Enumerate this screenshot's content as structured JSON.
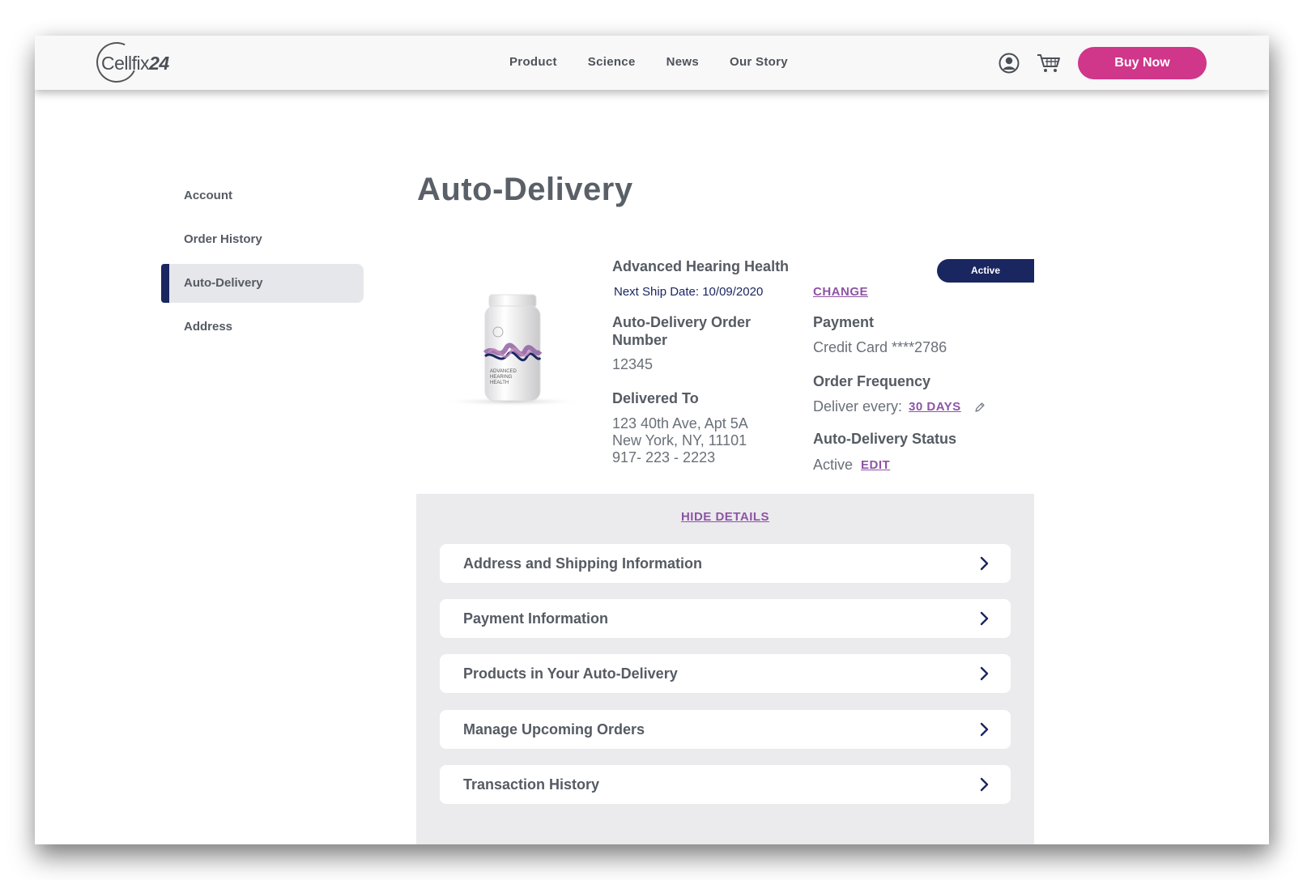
{
  "header": {
    "logo_text": "Cellfix",
    "logo_num": "24",
    "nav": [
      "Product",
      "Science",
      "News",
      "Our Story"
    ],
    "buy_label": "Buy Now"
  },
  "sidebar": {
    "items": [
      {
        "label": "Account",
        "active": false
      },
      {
        "label": "Order History",
        "active": false
      },
      {
        "label": "Auto-Delivery",
        "active": true
      },
      {
        "label": "Address",
        "active": false
      }
    ]
  },
  "page": {
    "title": "Auto-Delivery"
  },
  "order": {
    "product_name": "Advanced Hearing Health",
    "ship_date": "Next Ship Date: 10/09/2020",
    "change_label": "CHANGE",
    "status_badge": "Active",
    "order_num_label": "Auto-Delivery Order Number",
    "order_num": "12345",
    "delivered_label": "Delivered To",
    "address_line1": "123 40th Ave, Apt 5A",
    "address_line2": "New York, NY, 11101",
    "phone": "917- 223 - 2223",
    "payment_label": "Payment",
    "payment_value": "Credit Card ****2786",
    "freq_label": "Order Frequency",
    "freq_prefix": "Deliver every:",
    "freq_value": "30 DAYS",
    "status_label": "Auto-Delivery Status",
    "status_value": "Active",
    "edit_label": "EDIT"
  },
  "details": {
    "toggle_label": "HIDE DETAILS",
    "sections": [
      "Address and Shipping Information",
      "Payment Information",
      "Products in Your Auto-Delivery",
      "Manage Upcoming Orders",
      "Transaction History"
    ]
  },
  "product_label": {
    "line1": "ADVANCED",
    "line2": "HEARING",
    "line3": "HEALTH"
  },
  "colors": {
    "accent_pink": "#d0368a",
    "navy": "#1a2660",
    "link_purple": "#8e54a5",
    "panel_gray": "#ebebee"
  }
}
